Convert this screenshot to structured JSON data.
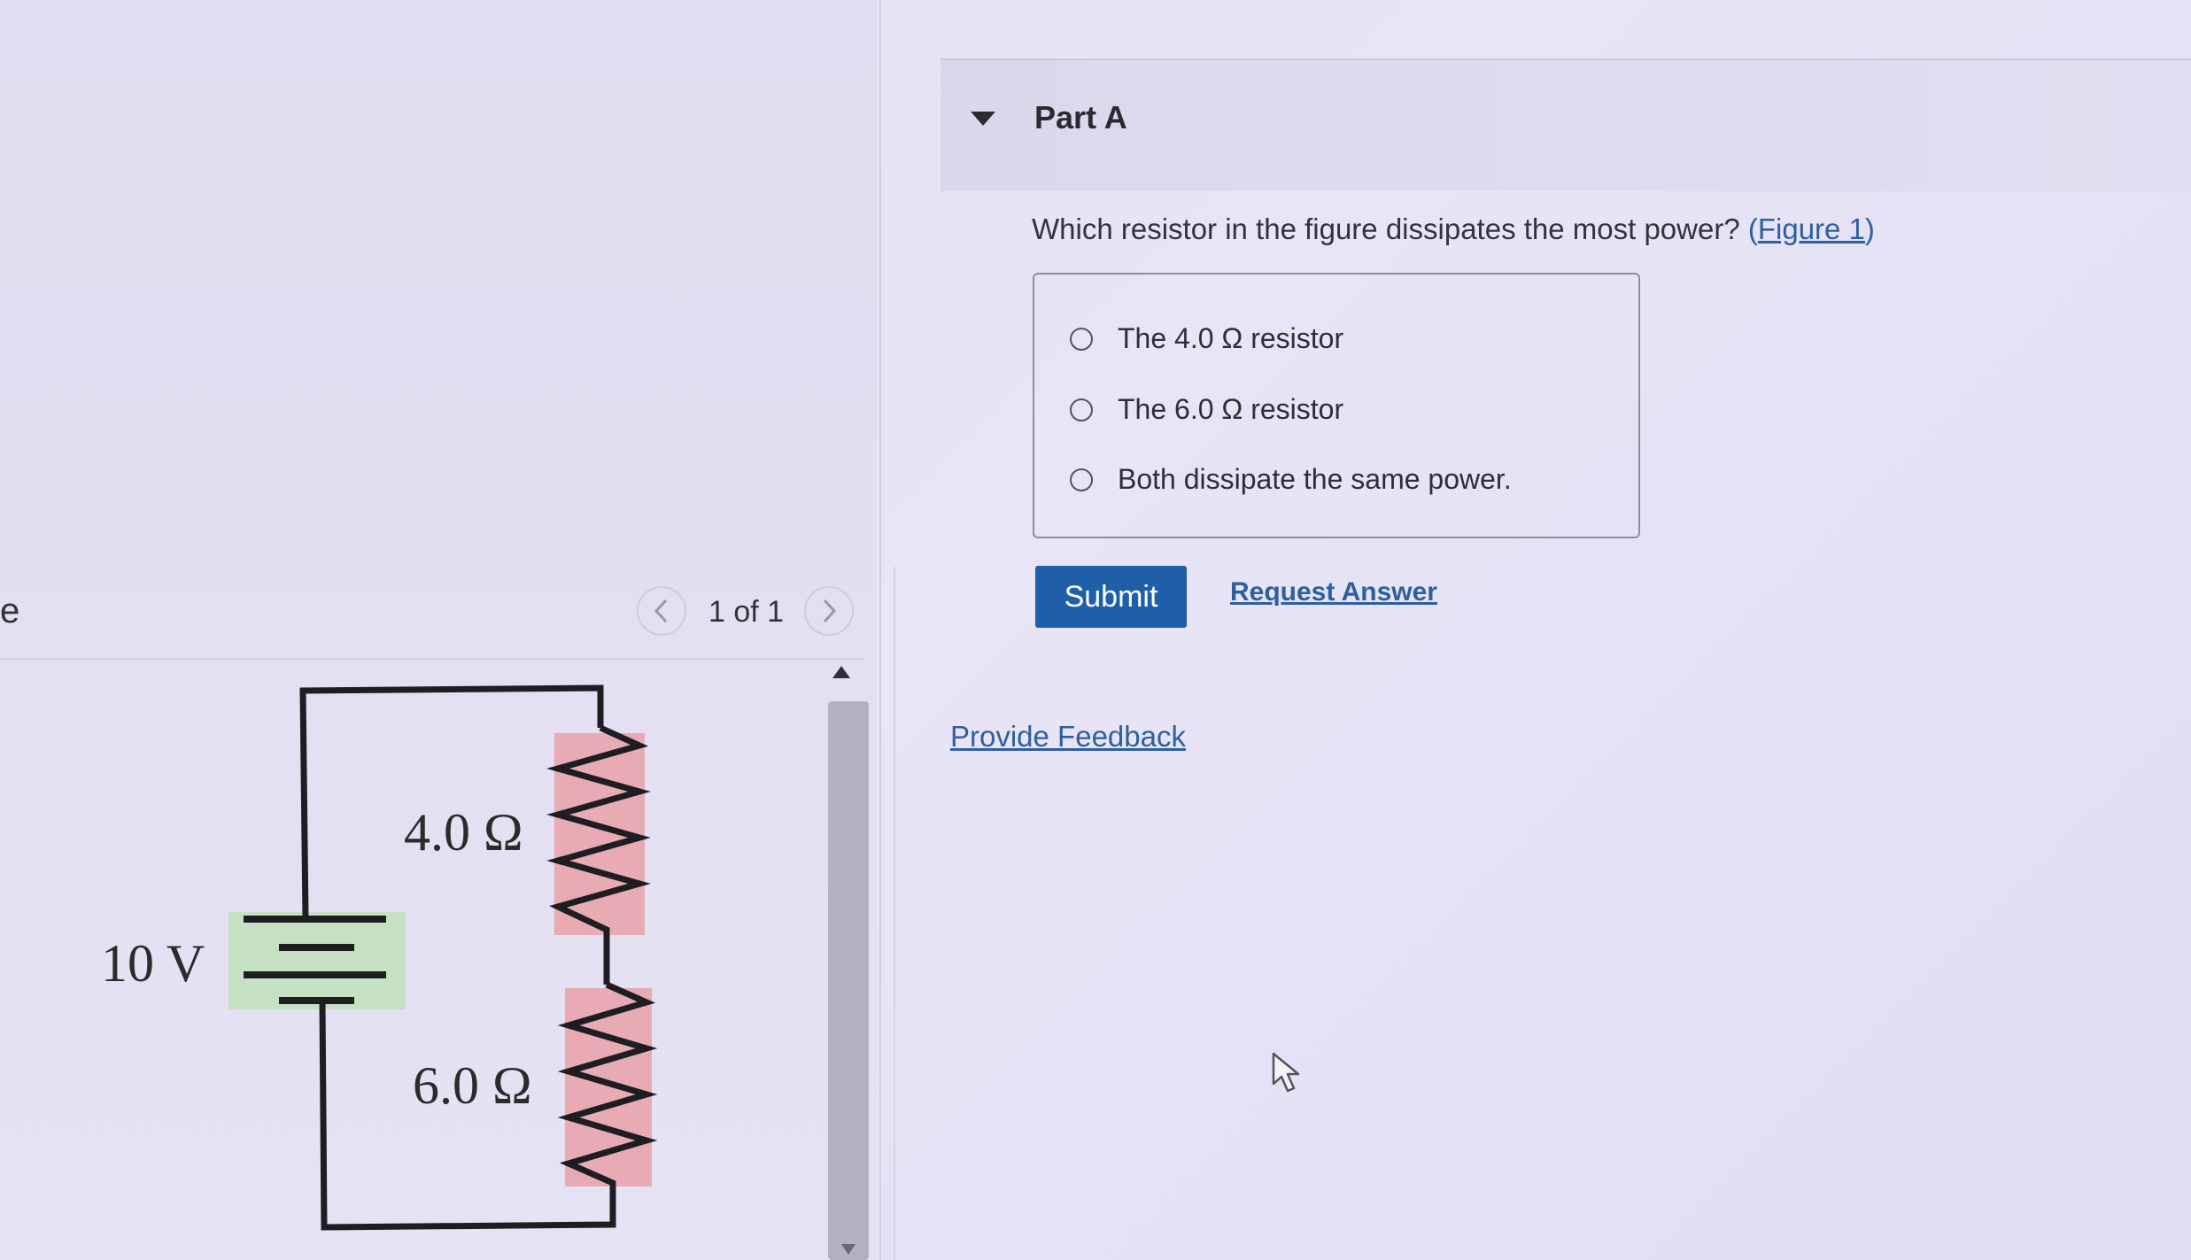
{
  "left_pane": {
    "edge_char": "e",
    "figure_nav": {
      "prev_icon": "chevron-left-icon",
      "next_icon": "chevron-right-icon",
      "counter": "1 of 1"
    },
    "circuit": {
      "battery_label": "10 V",
      "resistor_top_label": "4.0 Ω",
      "resistor_bottom_label": "6.0 Ω",
      "battery_highlight": "#c6e0c4",
      "resistor_highlight": "#e8aab3",
      "wire_color": "#1e1e22"
    }
  },
  "part": {
    "collapse_icon": "triangle-down-icon",
    "title": "Part A",
    "question": {
      "text": "Which resistor in the figure dissipates the most power? ",
      "open_paren": "(",
      "link": "Figure 1",
      "close_paren": ")"
    },
    "options": [
      "The 4.0 Ω resistor",
      "The 6.0 Ω resistor",
      "Both dissipate the same power."
    ],
    "submit_label": "Submit",
    "request_answer_label": "Request Answer"
  },
  "feedback_label": "Provide Feedback",
  "colors": {
    "primary_button": "#1f5fa8",
    "link": "#2e5f9e"
  }
}
